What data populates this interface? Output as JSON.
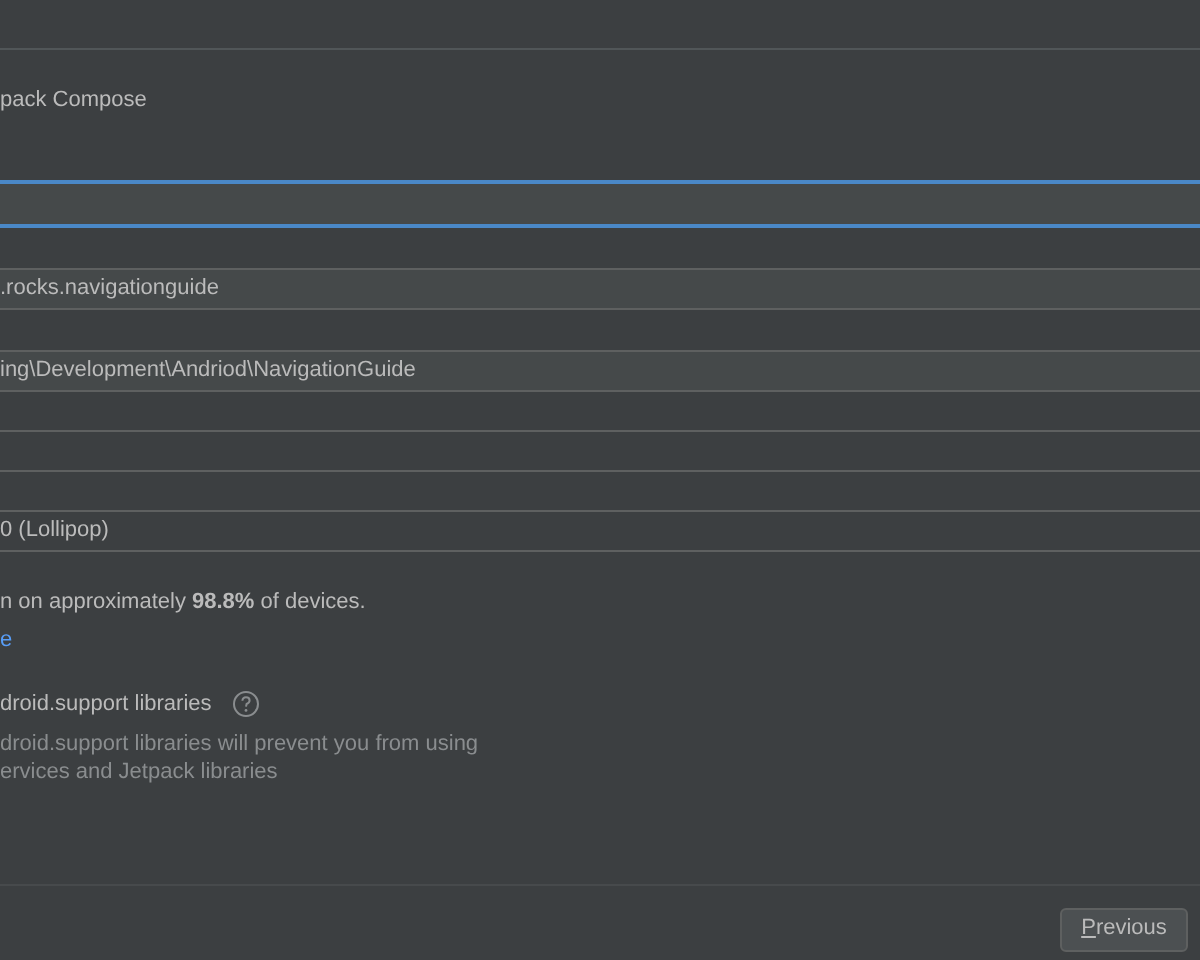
{
  "template_description": "pack Compose",
  "fields": [
    {
      "kind": "field",
      "focused": true
    },
    {
      "kind": "spacer"
    },
    {
      "kind": "field",
      "focused": false,
      "value": ".rocks.navigationguide"
    },
    {
      "kind": "spacer"
    },
    {
      "kind": "field",
      "focused": false,
      "value": "ing\\Development\\Andriod\\NavigationGuide"
    },
    {
      "kind": "dropdown"
    },
    {
      "kind": "dropdown"
    },
    {
      "kind": "dropdown"
    },
    {
      "kind": "dropdown",
      "value": "0 (Lollipop)"
    }
  ],
  "sdk_info": "n on approximately **98.8%** of devices.",
  "help_link": "e",
  "legacy_checkbox": {
    "label": "droid.support libraries"
  },
  "legacy_warning": [
    "droid.support libraries will prevent you from using",
    "ervices and Jetpack libraries"
  ],
  "buttons": [
    {
      "label": "Previous"
    }
  ]
}
